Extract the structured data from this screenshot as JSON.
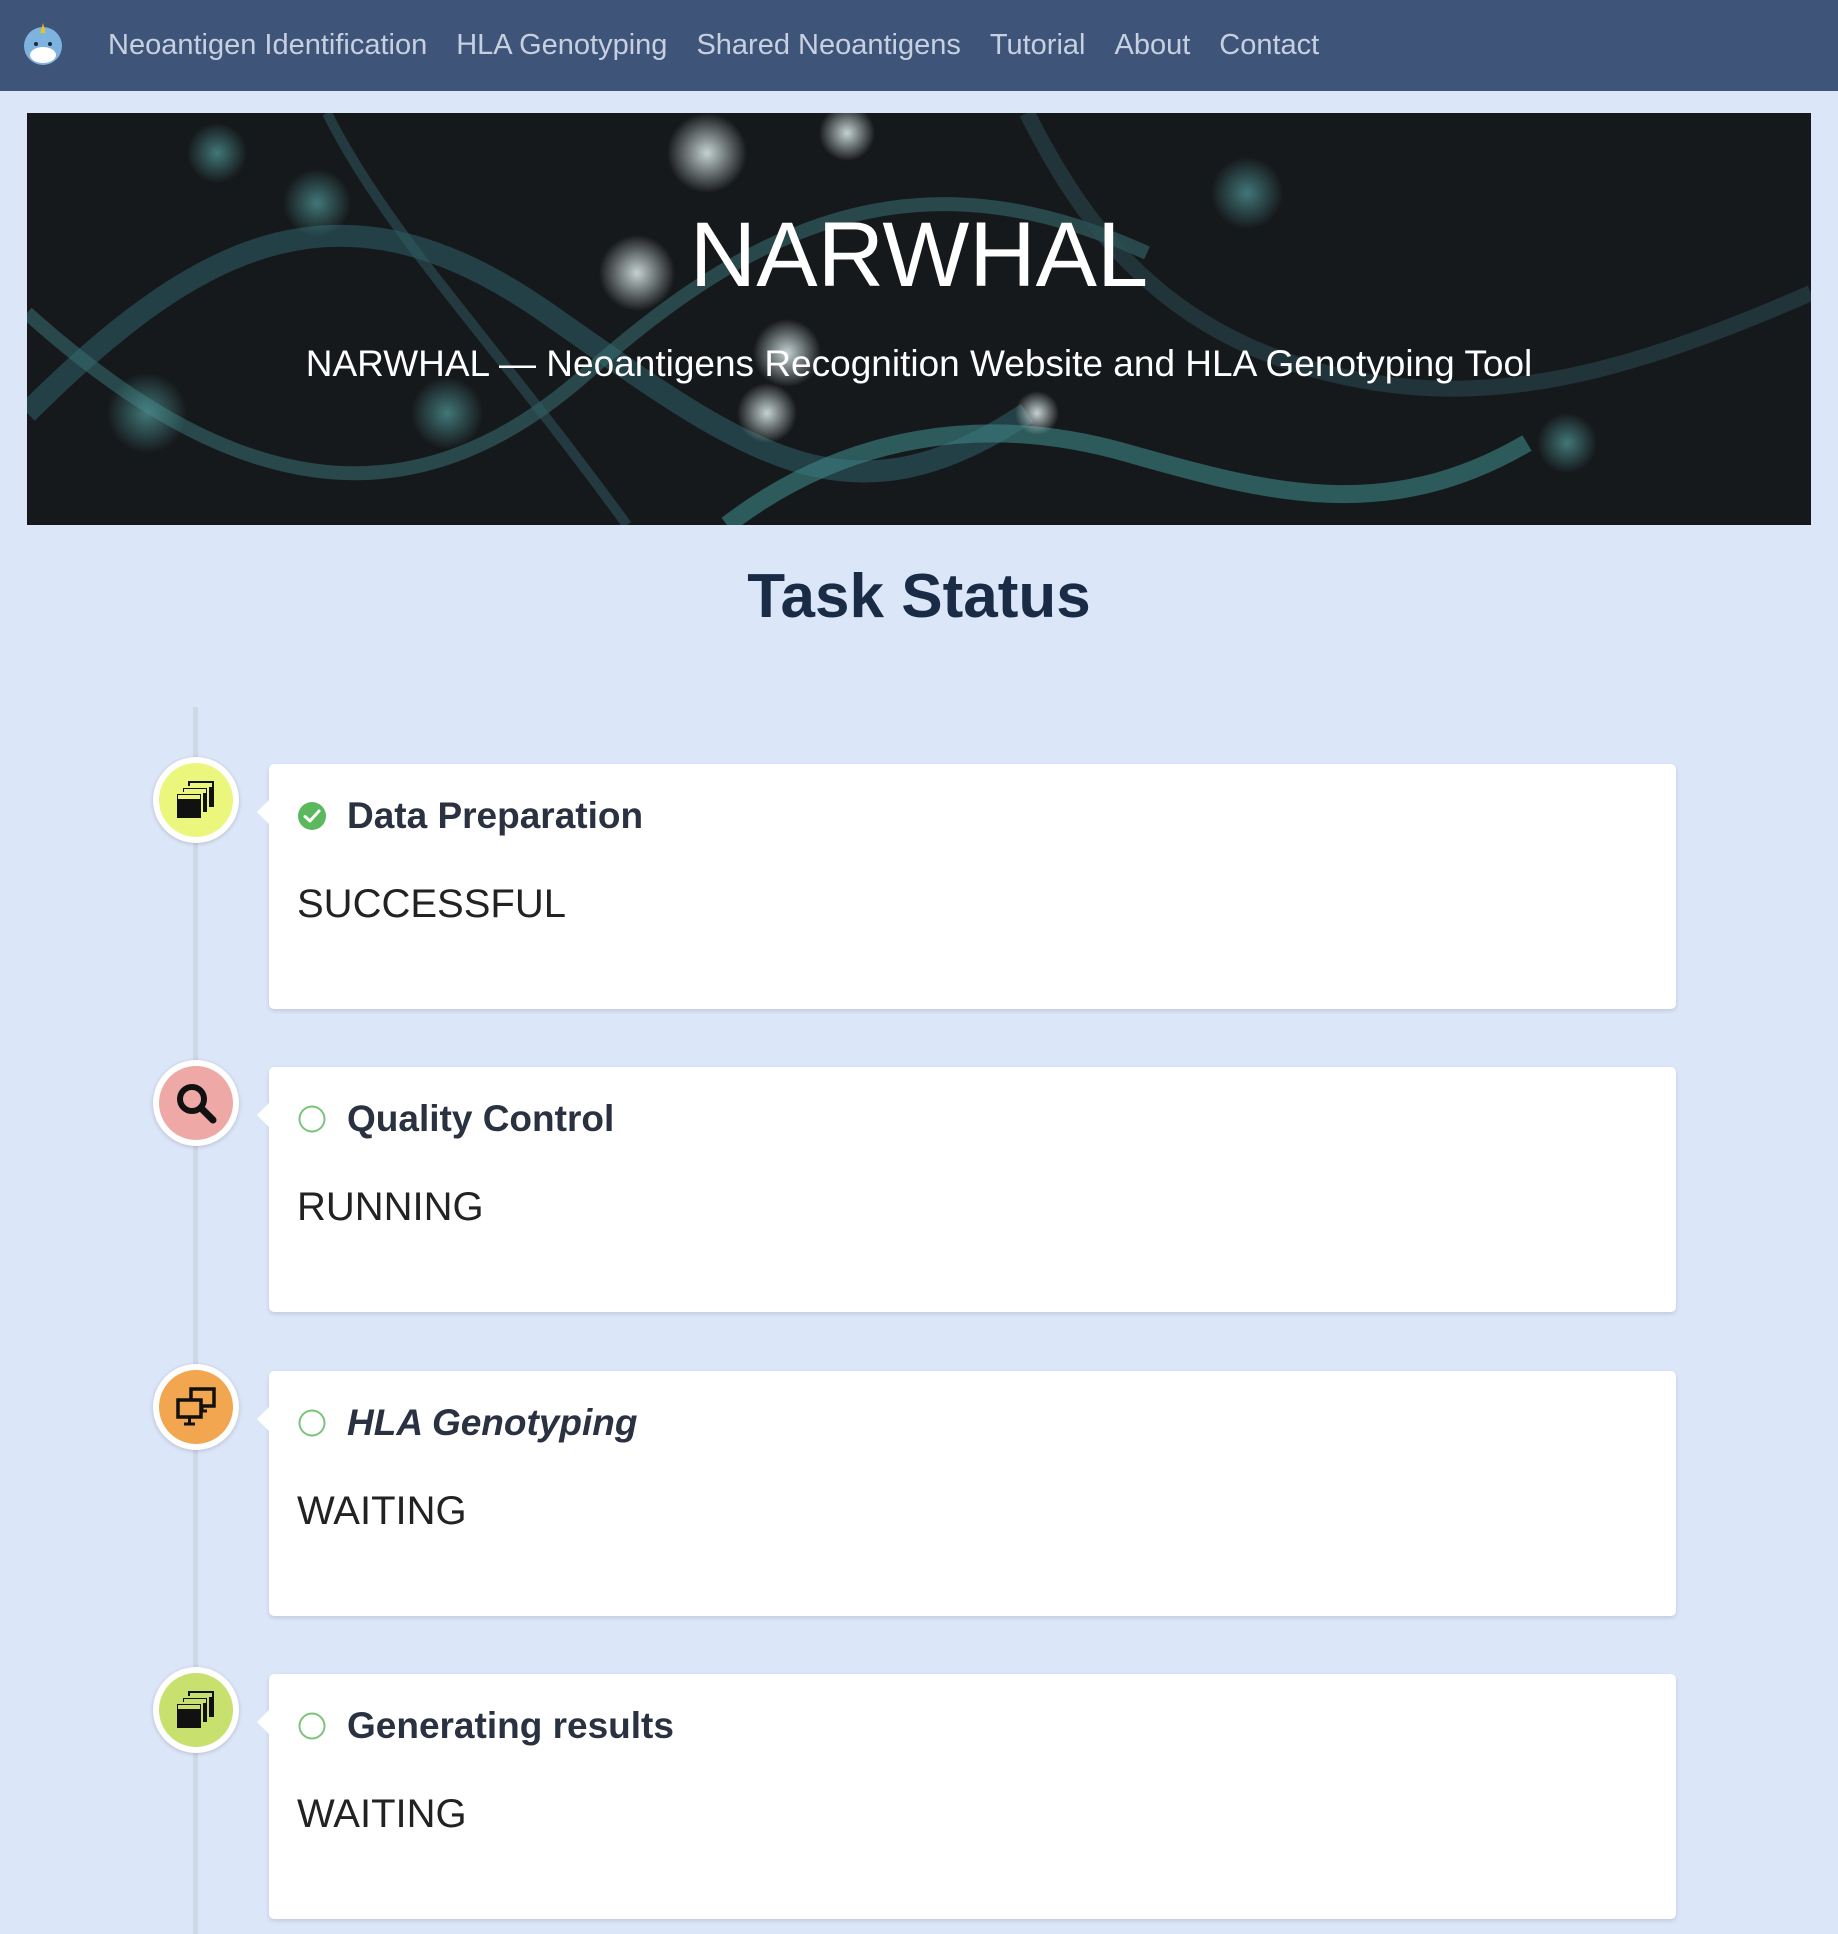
{
  "navbar": {
    "logo_icon": "narwhal-logo-icon",
    "links": [
      {
        "label": "Neoantigen Identification"
      },
      {
        "label": "HLA Genotyping"
      },
      {
        "label": "Shared Neoantigens"
      },
      {
        "label": "Tutorial"
      },
      {
        "label": "About"
      },
      {
        "label": "Contact"
      }
    ]
  },
  "hero": {
    "title": "NARWHAL",
    "subtitle": "NARWHAL — Neoantigens Recognition Website and HLA Genotyping Tool"
  },
  "section": {
    "title": "Task Status"
  },
  "steps": [
    {
      "title": "Data Preparation",
      "status": "SUCCESSFUL",
      "icon": "stacked-windows-icon",
      "icon_bg": "#eaf77c",
      "state_icon": "check-circle-icon"
    },
    {
      "title": "Quality Control",
      "status": "RUNNING",
      "icon": "magnifier-icon",
      "icon_bg": "#eea8a5",
      "state_icon": "empty-circle-icon"
    },
    {
      "title": "HLA Genotyping",
      "status": "WAITING",
      "icon": "monitors-icon",
      "icon_bg": "#f2a650",
      "state_icon": "empty-circle-icon"
    },
    {
      "title": "Generating results",
      "status": "WAITING",
      "icon": "stacked-windows-icon",
      "icon_bg": "#c8e06d",
      "state_icon": "empty-circle-icon"
    }
  ],
  "colors": {
    "navbar_bg": "#3f5479",
    "page_bg": "#dce6f9",
    "success_green": "#5cb85c"
  }
}
